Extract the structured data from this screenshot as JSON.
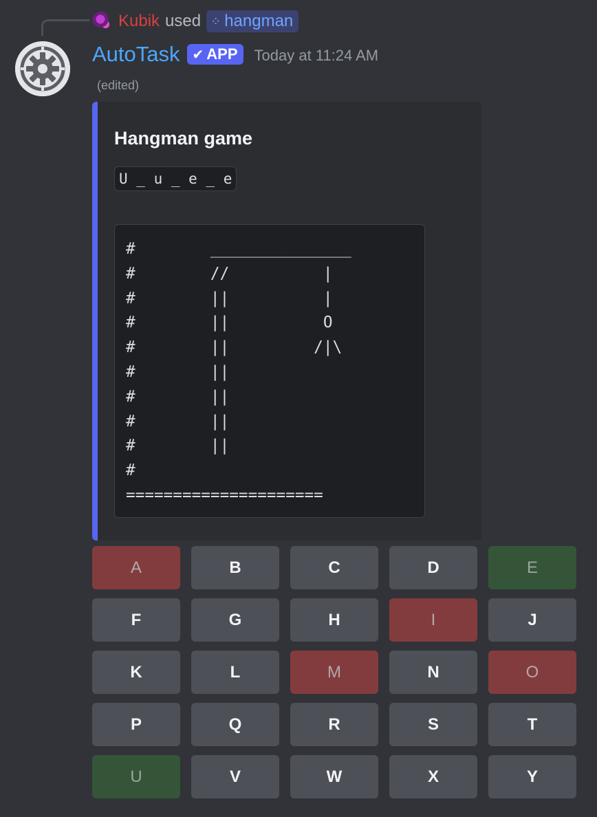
{
  "reply": {
    "user": "Kubik",
    "used": "used",
    "command": "hangman",
    "command_icon": "apps-icon"
  },
  "message": {
    "author": "AutoTask",
    "badge": "APP",
    "timestamp": "Today at 11:24 AM",
    "edited": "(edited)"
  },
  "embed": {
    "accent_color": "#5865f2",
    "title": "Hangman game",
    "word": "U _ u _ e _ e",
    "gallows_art": "#        _______________\n#        //          |\n#        ||          |\n#        ||          O\n#        ||         /|\\\n#        ||\n#        ||\n#        ||\n#        ||\n#\n====================="
  },
  "colors": {
    "wrong": "#833c3d",
    "correct": "#355539",
    "neutral": "#4e5058"
  },
  "keys": [
    {
      "letter": "A",
      "state": "wrong"
    },
    {
      "letter": "B",
      "state": "neutral"
    },
    {
      "letter": "C",
      "state": "neutral"
    },
    {
      "letter": "D",
      "state": "neutral"
    },
    {
      "letter": "E",
      "state": "correct"
    },
    {
      "letter": "F",
      "state": "neutral"
    },
    {
      "letter": "G",
      "state": "neutral"
    },
    {
      "letter": "H",
      "state": "neutral"
    },
    {
      "letter": "I",
      "state": "wrong"
    },
    {
      "letter": "J",
      "state": "neutral"
    },
    {
      "letter": "K",
      "state": "neutral"
    },
    {
      "letter": "L",
      "state": "neutral"
    },
    {
      "letter": "M",
      "state": "wrong"
    },
    {
      "letter": "N",
      "state": "neutral"
    },
    {
      "letter": "O",
      "state": "wrong"
    },
    {
      "letter": "P",
      "state": "neutral"
    },
    {
      "letter": "Q",
      "state": "neutral"
    },
    {
      "letter": "R",
      "state": "neutral"
    },
    {
      "letter": "S",
      "state": "neutral"
    },
    {
      "letter": "T",
      "state": "neutral"
    },
    {
      "letter": "U",
      "state": "correct"
    },
    {
      "letter": "V",
      "state": "neutral"
    },
    {
      "letter": "W",
      "state": "neutral"
    },
    {
      "letter": "X",
      "state": "neutral"
    },
    {
      "letter": "Y",
      "state": "neutral"
    }
  ]
}
